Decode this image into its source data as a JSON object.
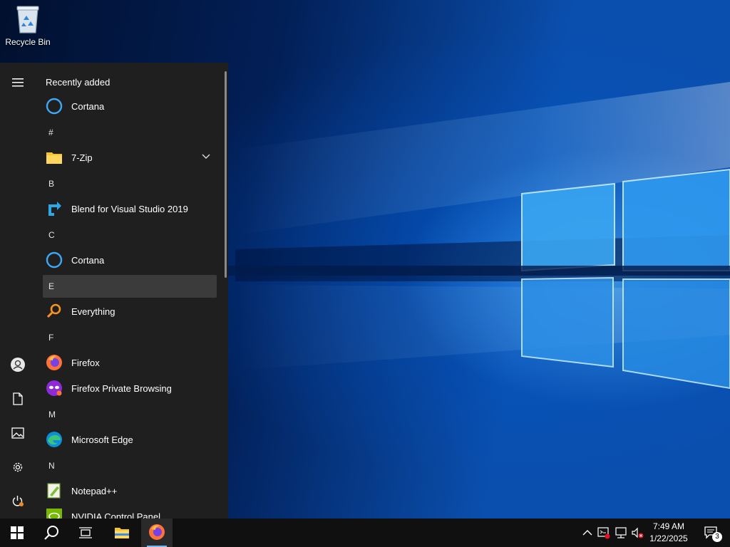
{
  "desktop": {
    "icons": [
      {
        "label": "Recycle Bin",
        "icon": "recycle-bin-icon"
      }
    ]
  },
  "start_menu": {
    "sections": {
      "recently_added": "Recently added",
      "hash": "#",
      "b": "B",
      "c": "C",
      "e": "E",
      "f": "F",
      "m": "M",
      "n": "N"
    },
    "apps": {
      "cortana_recent": "Cortana",
      "seven_zip": "7-Zip",
      "blend": "Blend for Visual Studio 2019",
      "cortana": "Cortana",
      "everything": "Everything",
      "firefox": "Firefox",
      "firefox_private": "Firefox Private Browsing",
      "edge": "Microsoft Edge",
      "notepadpp": "Notepad++",
      "nvidia": "NVIDIA Control Panel"
    },
    "rail_icons": [
      "hamburger-menu-icon",
      "user-account-icon",
      "documents-icon",
      "pictures-icon",
      "settings-gear-icon",
      "power-icon"
    ]
  },
  "taskbar": {
    "clock": {
      "time": "7:49 AM",
      "date": "1/22/2025"
    },
    "notification_count": "3",
    "pinned": [
      "start-windows-icon",
      "search-icon",
      "task-view-icon",
      "file-explorer-icon",
      "firefox-icon"
    ],
    "tray": [
      "show-hidden-icons-chevron",
      "security-alert-icon",
      "network-icon",
      "volume-muted-icon"
    ]
  },
  "colors": {
    "start_bg": "#1f1f1f",
    "taskbar_bg": "#101010",
    "accent": "#76b9ed",
    "highlight": "#3b3b3b"
  }
}
